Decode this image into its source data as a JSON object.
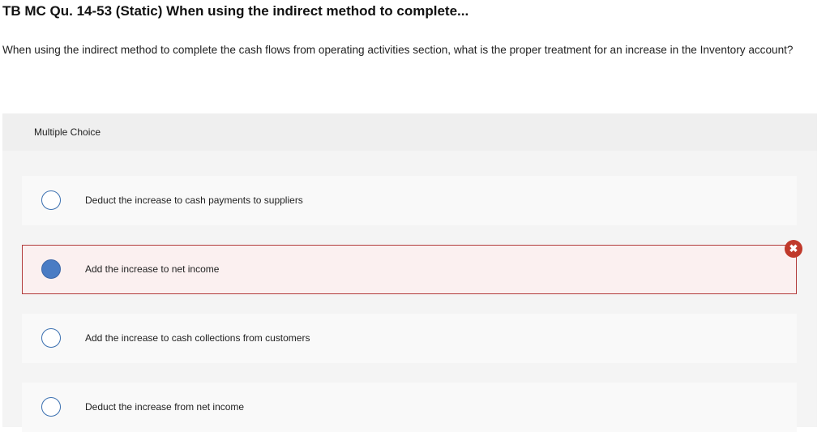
{
  "question": {
    "title": "TB MC Qu. 14-53 (Static) When using the indirect method to complete...",
    "text": "When using the indirect method to complete the cash flows from operating activities section, what is the proper treatment for an increase in the Inventory account?"
  },
  "multiple_choice": {
    "label": "Multiple Choice",
    "options": [
      {
        "label": "Deduct the increase to cash payments to suppliers",
        "selected": false
      },
      {
        "label": "Add the increase to net income",
        "selected": true,
        "status": "incorrect"
      },
      {
        "label": "Add the increase to cash collections from customers",
        "selected": false
      },
      {
        "label": "Deduct the increase from net income",
        "selected": false
      }
    ]
  },
  "feedback": {
    "incorrect_icon": "x-circle-icon",
    "incorrect_symbol": "✖"
  },
  "colors": {
    "radio_selected": "#4a7cc4",
    "radio_border": "#3a6fb0",
    "incorrect_border": "#b23b3b",
    "incorrect_badge": "#c0392b"
  }
}
